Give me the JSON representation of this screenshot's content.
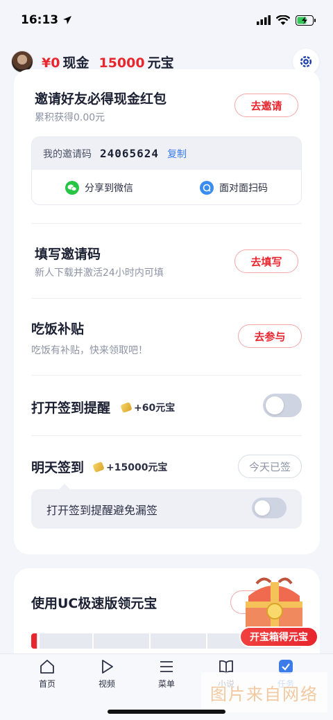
{
  "status_bar": {
    "time": "16:13"
  },
  "header": {
    "cash_amount": "¥0",
    "cash_label": "现金",
    "yuanbao_amount": "15000",
    "yuanbao_label": "元宝"
  },
  "invite": {
    "title": "邀请好友必得现金红包",
    "subtitle": "累积获得0.00元",
    "button": "去邀请",
    "code_label": "我的邀请码",
    "code_value": "24065624",
    "copy_label": "复制",
    "share_wechat": "分享到微信",
    "share_scan": "面对面扫码"
  },
  "fill_code": {
    "title": "填写邀请码",
    "subtitle": "新人下载并激活24小时内可填",
    "button": "去填写"
  },
  "meal": {
    "title": "吃饭补贴",
    "subtitle": "吃饭有补贴，快来领取吧！",
    "button": "去参与"
  },
  "signin_reminder": {
    "title": "打开签到提醒",
    "bonus": "+60元宝",
    "toggle_on": false
  },
  "tomorrow_signin": {
    "title": "明天签到",
    "bonus": "+15000元宝",
    "button": "今天已签",
    "reminder_text": "打开签到提醒避免漏签",
    "toggle_on": false
  },
  "uc_card": {
    "title": "使用UC极速版领元宝",
    "progress": 0.02
  },
  "treasure": {
    "button": "开宝箱得元宝"
  },
  "tabs": [
    {
      "label": "首页",
      "icon": "home-icon"
    },
    {
      "label": "视频",
      "icon": "play-icon"
    },
    {
      "label": "菜单",
      "icon": "menu-icon"
    },
    {
      "label": "小说",
      "icon": "book-icon"
    },
    {
      "label": "任务",
      "icon": "task-check-icon"
    }
  ],
  "watermark": "图片来自网络",
  "colors": {
    "accent_red": "#e8262e",
    "link_blue": "#3b7ce8",
    "text_dark": "#1b2033"
  }
}
